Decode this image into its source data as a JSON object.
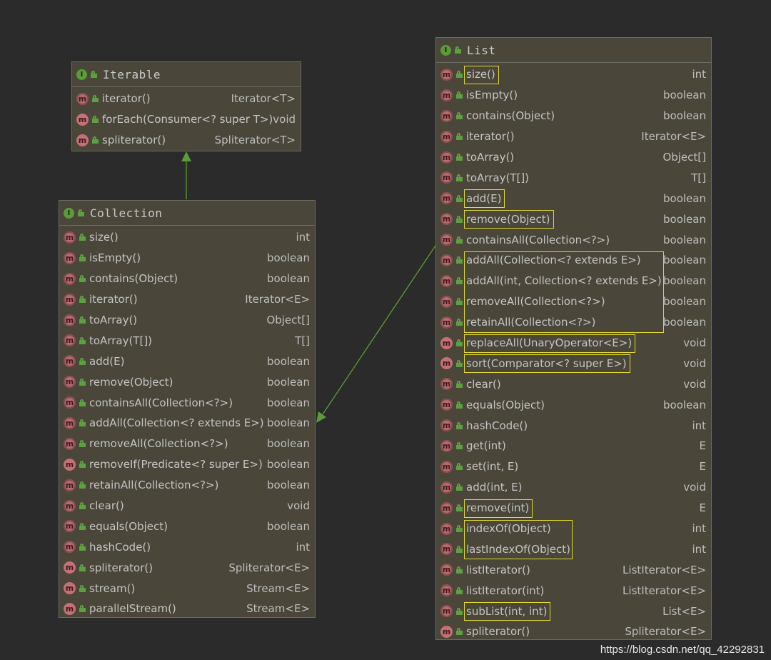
{
  "colors": {
    "background": "#2b2b2b",
    "box_fill": "#4a473a",
    "arrow": "#5d9a3a",
    "highlight": "#e2d831"
  },
  "iterable": {
    "title": "Iterable",
    "methods": [
      {
        "name": "iterator()",
        "type": "Iterator<T>",
        "abstract": true
      },
      {
        "name": "forEach(Consumer<? super T>)",
        "type": "void",
        "abstract": false
      },
      {
        "name": "spliterator()",
        "type": "Spliterator<T>",
        "abstract": false
      }
    ]
  },
  "collection": {
    "title": "Collection",
    "methods": [
      {
        "name": "size()",
        "type": "int",
        "abstract": true
      },
      {
        "name": "isEmpty()",
        "type": "boolean",
        "abstract": true
      },
      {
        "name": "contains(Object)",
        "type": "boolean",
        "abstract": true
      },
      {
        "name": "iterator()",
        "type": "Iterator<E>",
        "abstract": true
      },
      {
        "name": "toArray()",
        "type": "Object[]",
        "abstract": true
      },
      {
        "name": "toArray(T[])",
        "type": "T[]",
        "abstract": true
      },
      {
        "name": "add(E)",
        "type": "boolean",
        "abstract": true
      },
      {
        "name": "remove(Object)",
        "type": "boolean",
        "abstract": true
      },
      {
        "name": "containsAll(Collection<?>)",
        "type": "boolean",
        "abstract": true
      },
      {
        "name": "addAll(Collection<? extends E>)",
        "type": "boolean",
        "abstract": true
      },
      {
        "name": "removeAll(Collection<?>)",
        "type": "boolean",
        "abstract": true
      },
      {
        "name": "removeIf(Predicate<? super E>)",
        "type": "boolean",
        "abstract": false
      },
      {
        "name": "retainAll(Collection<?>)",
        "type": "boolean",
        "abstract": true
      },
      {
        "name": "clear()",
        "type": "void",
        "abstract": true
      },
      {
        "name": "equals(Object)",
        "type": "boolean",
        "abstract": true
      },
      {
        "name": "hashCode()",
        "type": "int",
        "abstract": true
      },
      {
        "name": "spliterator()",
        "type": "Spliterator<E>",
        "abstract": false
      },
      {
        "name": "stream()",
        "type": "Stream<E>",
        "abstract": false
      },
      {
        "name": "parallelStream()",
        "type": "Stream<E>",
        "abstract": false
      }
    ]
  },
  "list": {
    "title": "List",
    "methods": [
      {
        "name": "size()",
        "type": "int",
        "abstract": true,
        "highlight": true
      },
      {
        "name": "isEmpty()",
        "type": "boolean",
        "abstract": true
      },
      {
        "name": "contains(Object)",
        "type": "boolean",
        "abstract": true
      },
      {
        "name": "iterator()",
        "type": "Iterator<E>",
        "abstract": true
      },
      {
        "name": "toArray()",
        "type": "Object[]",
        "abstract": true
      },
      {
        "name": "toArray(T[])",
        "type": "T[]",
        "abstract": true
      },
      {
        "name": "add(E)",
        "type": "boolean",
        "abstract": true,
        "highlight": true
      },
      {
        "name": "remove(Object)",
        "type": "boolean",
        "abstract": true,
        "highlight": true
      },
      {
        "name": "containsAll(Collection<?>)",
        "type": "boolean",
        "abstract": true
      },
      {
        "name": "addAll(Collection<? extends E>)",
        "type": "boolean",
        "abstract": true
      },
      {
        "name": "addAll(int, Collection<? extends E>)",
        "type": "boolean",
        "abstract": true
      },
      {
        "name": "removeAll(Collection<?>)",
        "type": "boolean",
        "abstract": true
      },
      {
        "name": "retainAll(Collection<?>)",
        "type": "boolean",
        "abstract": true
      },
      {
        "name": "replaceAll(UnaryOperator<E>)",
        "type": "void",
        "abstract": false,
        "highlight": true
      },
      {
        "name": "sort(Comparator<? super E>)",
        "type": "void",
        "abstract": false,
        "highlight": true
      },
      {
        "name": "clear()",
        "type": "void",
        "abstract": true
      },
      {
        "name": "equals(Object)",
        "type": "boolean",
        "abstract": true
      },
      {
        "name": "hashCode()",
        "type": "int",
        "abstract": true
      },
      {
        "name": "get(int)",
        "type": "E",
        "abstract": true
      },
      {
        "name": "set(int, E)",
        "type": "E",
        "abstract": true
      },
      {
        "name": "add(int, E)",
        "type": "void",
        "abstract": true
      },
      {
        "name": "remove(int)",
        "type": "E",
        "abstract": true,
        "highlight": true
      },
      {
        "name": "indexOf(Object)",
        "type": "int",
        "abstract": true
      },
      {
        "name": "lastIndexOf(Object)",
        "type": "int",
        "abstract": true
      },
      {
        "name": "listIterator()",
        "type": "ListIterator<E>",
        "abstract": true
      },
      {
        "name": "listIterator(int)",
        "type": "ListIterator<E>",
        "abstract": true
      },
      {
        "name": "subList(int, int)",
        "type": "List<E>",
        "abstract": true,
        "highlight": true
      },
      {
        "name": "spliterator()",
        "type": "Spliterator<E>",
        "abstract": false
      }
    ],
    "highlight_groups": [
      {
        "from": 9,
        "to": 12
      },
      {
        "from": 22,
        "to": 23
      }
    ]
  },
  "watermark": "https://blog.csdn.net/qq_42292831"
}
